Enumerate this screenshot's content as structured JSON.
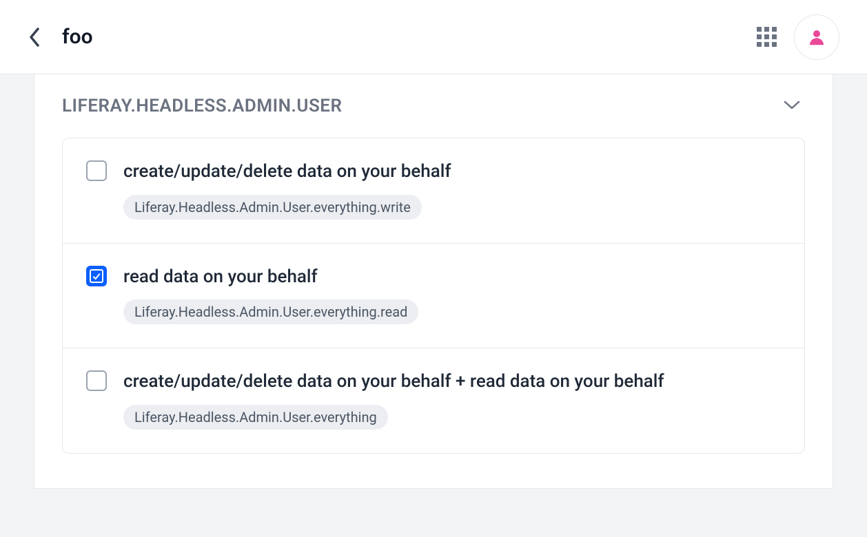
{
  "header": {
    "title": "foo"
  },
  "section": {
    "title": "LIFERAY.HEADLESS.ADMIN.USER"
  },
  "scopes": [
    {
      "label": "create/update/delete data on your behalf",
      "id": "Liferay.Headless.Admin.User.everything.write",
      "checked": false
    },
    {
      "label": "read data on your behalf",
      "id": "Liferay.Headless.Admin.User.everything.read",
      "checked": true
    },
    {
      "label": "create/update/delete data on your behalf + read data on your behalf",
      "id": "Liferay.Headless.Admin.User.everything",
      "checked": false
    }
  ]
}
